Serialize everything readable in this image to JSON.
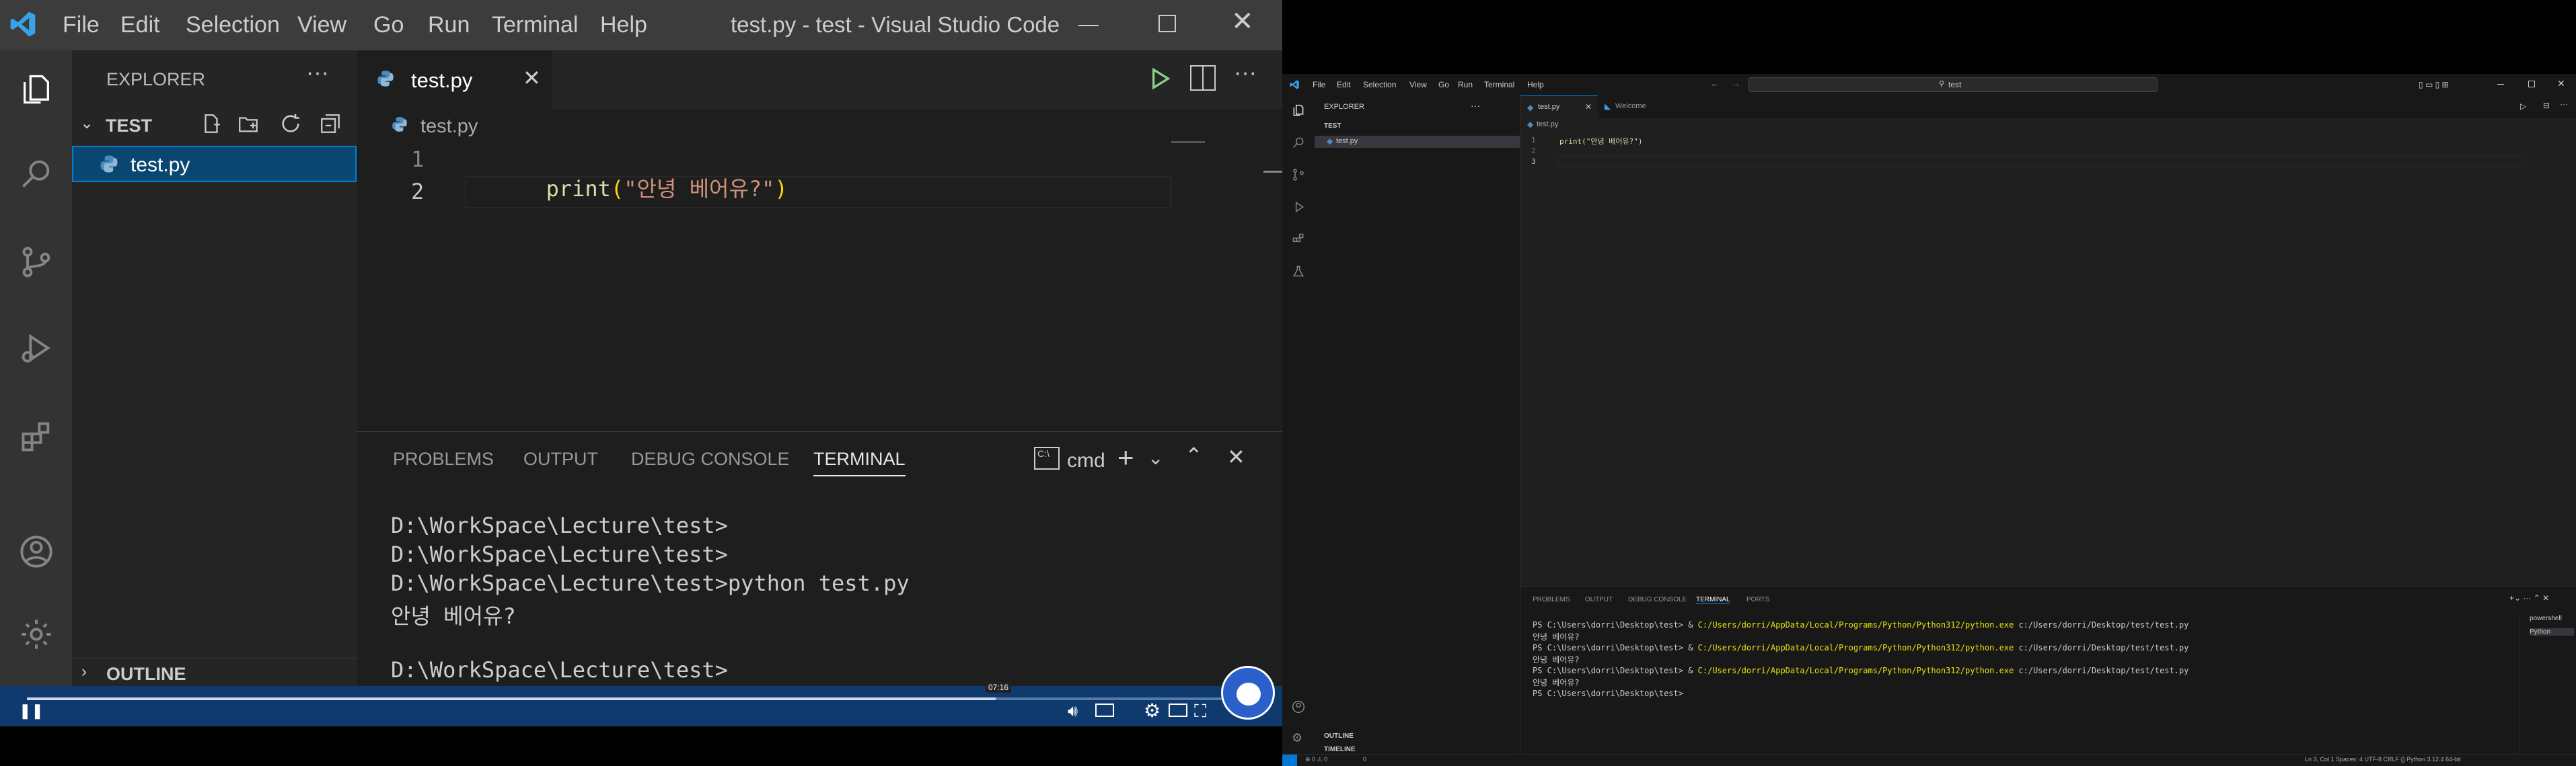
{
  "left": {
    "window_title": "test.py - test - Visual Studio Code",
    "menu": [
      "File",
      "Edit",
      "Selection",
      "View",
      "Go",
      "Run",
      "Terminal",
      "Help"
    ],
    "sidebar": {
      "title": "EXPLORER",
      "folder": "TEST",
      "file": "test.py",
      "outline": "OUTLINE"
    },
    "tab": {
      "label": "test.py"
    },
    "breadcrumb": "test.py",
    "code": [
      {
        "num": "1",
        "fn": "print",
        "paren_open": "(",
        "str": "\"안녕 베어유?\"",
        "paren_close": ")"
      },
      {
        "num": "2"
      }
    ],
    "panel_tabs": [
      "PROBLEMS",
      "OUTPUT",
      "DEBUG CONSOLE",
      "TERMINAL"
    ],
    "terminal_shell": "cmd",
    "terminal_lines": [
      "D:\\WorkSpace\\Lecture\\test>",
      "D:\\WorkSpace\\Lecture\\test>",
      "D:\\WorkSpace\\Lecture\\test>python test.py",
      "안녕 베어유?",
      "",
      "D:\\WorkSpace\\Lecture\\test>"
    ],
    "video_time": "07:16"
  },
  "right": {
    "menu": [
      "File",
      "Edit",
      "Selection",
      "View",
      "Go",
      "Run",
      "Terminal",
      "Help"
    ],
    "search": "test",
    "sidebar_title": "EXPLORER",
    "folder": "TEST",
    "file": "test.py",
    "outline": "OUTLINE",
    "timeline": "TIMELINE",
    "tabs": [
      "test.py",
      "Welcome"
    ],
    "breadcrumb": "test.py",
    "code": [
      {
        "num": "1",
        "text": "print(\"안녕 베어유?\")"
      },
      {
        "num": "2",
        "text": ""
      },
      {
        "num": "3",
        "text": ""
      }
    ],
    "panel_tabs": [
      "PROBLEMS",
      "OUTPUT",
      "DEBUG CONSOLE",
      "TERMINAL",
      "PORTS"
    ],
    "terminal_lines": [
      {
        "prompt": "PS C:\\Users\\dorri\\Desktop\\test> & ",
        "path": "C:/Users/dorri/AppData/Local/Programs/Python/Python312/python.exe",
        "arg": " c:/Users/dorri/Desktop/test/test.py"
      },
      {
        "prompt": "안녕 베어유?",
        "path": "",
        "arg": ""
      },
      {
        "prompt": "PS C:\\Users\\dorri\\Desktop\\test> & ",
        "path": "C:/Users/dorri/AppData/Local/Programs/Python/Python312/python.exe",
        "arg": " c:/Users/dorri/Desktop/test/test.py"
      },
      {
        "prompt": "안녕 베어유?",
        "path": "",
        "arg": ""
      },
      {
        "prompt": "PS C:\\Users\\dorri\\Desktop\\test> & ",
        "path": "C:/Users/dorri/AppData/Local/Programs/Python/Python312/python.exe",
        "arg": " c:/Users/dorri/Desktop/test/test.py"
      },
      {
        "prompt": "안녕 베어유?",
        "path": "",
        "arg": ""
      },
      {
        "prompt": "PS C:\\Users\\dorri\\Desktop\\test>",
        "path": "",
        "arg": ""
      }
    ],
    "terminal_list": [
      "powershell",
      "Python"
    ],
    "status": {
      "errors": "⊗ 0 ⚠ 0",
      "ports": "0",
      "right": "Ln 3, Col 1   Spaces: 4   UTF-8   CRLF   {} Python   3.12.4 64-bit"
    }
  }
}
